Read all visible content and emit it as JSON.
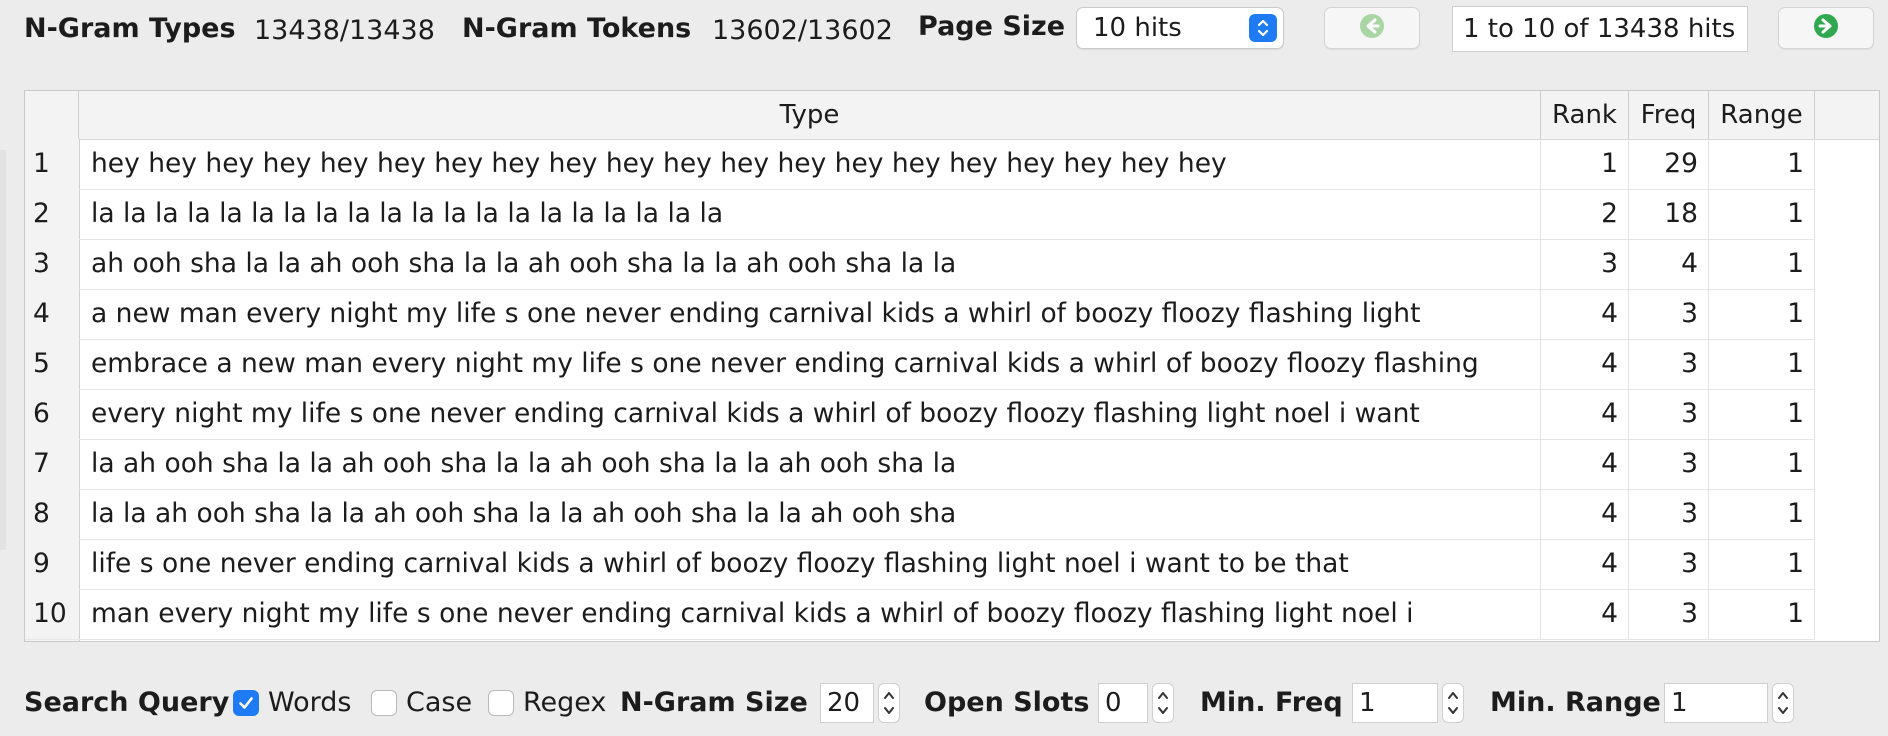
{
  "toolbar": {
    "ngram_types_label": "N-Gram Types",
    "ngram_types_value": "13438/13438",
    "ngram_tokens_label": "N-Gram Tokens",
    "ngram_tokens_value": "13602/13602",
    "page_size_label": "Page Size",
    "page_size_value": "10 hits",
    "page_info": "1 to 10 of 13438 hits",
    "prev_icon": "arrow-left-circle-icon",
    "next_icon": "arrow-right-circle-icon",
    "prev_color": "#a9d6a4",
    "next_color": "#2fa84f"
  },
  "table": {
    "columns": [
      "Type",
      "Rank",
      "Freq",
      "Range"
    ],
    "rows": [
      {
        "n": "1",
        "type": "hey hey hey hey hey hey hey hey hey hey hey hey hey hey hey hey hey hey hey hey",
        "rank": "1",
        "freq": "29",
        "range": "1"
      },
      {
        "n": "2",
        "type": "la la la la la la la la la la la la la la la la la la la la",
        "rank": "2",
        "freq": "18",
        "range": "1"
      },
      {
        "n": "3",
        "type": "ah ooh sha la la ah ooh sha la la ah ooh sha la la ah ooh sha la la",
        "rank": "3",
        "freq": "4",
        "range": "1"
      },
      {
        "n": "4",
        "type": "a new man every night my life s one never ending carnival kids a whirl of boozy floozy flashing light",
        "rank": "4",
        "freq": "3",
        "range": "1"
      },
      {
        "n": "5",
        "type": "embrace a new man every night my life s one never ending carnival kids a whirl of boozy floozy flashing",
        "rank": "4",
        "freq": "3",
        "range": "1"
      },
      {
        "n": "6",
        "type": "every night my life s one never ending carnival kids a whirl of boozy floozy flashing light noel i want",
        "rank": "4",
        "freq": "3",
        "range": "1"
      },
      {
        "n": "7",
        "type": "la ah ooh sha la la ah ooh sha la la ah ooh sha la la ah ooh sha la",
        "rank": "4",
        "freq": "3",
        "range": "1"
      },
      {
        "n": "8",
        "type": "la la ah ooh sha la la ah ooh sha la la ah ooh sha la la ah ooh sha",
        "rank": "4",
        "freq": "3",
        "range": "1"
      },
      {
        "n": "9",
        "type": "life s one never ending carnival kids a whirl of boozy floozy flashing light noel i want to be that",
        "rank": "4",
        "freq": "3",
        "range": "1"
      },
      {
        "n": "10",
        "type": "man every night my life s one never ending carnival kids a whirl of boozy floozy flashing light noel i",
        "rank": "4",
        "freq": "3",
        "range": "1"
      }
    ]
  },
  "search": {
    "label": "Search Query",
    "words_label": "Words",
    "words_checked": true,
    "case_label": "Case",
    "case_checked": false,
    "regex_label": "Regex",
    "regex_checked": false,
    "ngram_size_label": "N-Gram Size",
    "ngram_size_value": "20",
    "open_slots_label": "Open Slots",
    "open_slots_value": "0",
    "min_freq_label": "Min. Freq",
    "min_freq_value": "1",
    "min_range_label": "Min. Range",
    "min_range_value": "1",
    "accent_color": "#1f7bf3"
  }
}
